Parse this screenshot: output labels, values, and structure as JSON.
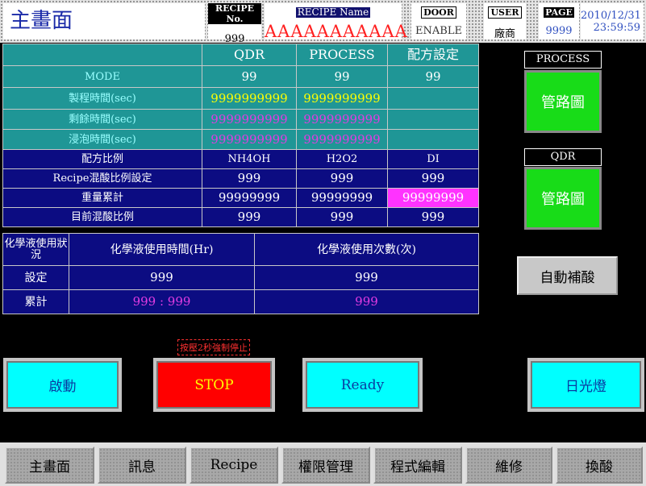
{
  "header": {
    "title": "主畫面",
    "recipe_no_label": "RECIPE No.",
    "recipe_no_value": "999",
    "recipe_name_label": "RECIPE Name",
    "recipe_name_value": "AAAAAAAAAAA",
    "door_label": "DOOR",
    "door_value": "ENABLE",
    "user_label": "USER",
    "user_value": "廠商",
    "page_label": "PAGE",
    "page_value": "9999",
    "date": "2010/12/31",
    "time": "23:59:59"
  },
  "main_table": {
    "columns": [
      "QDR",
      "PROCESS",
      "配方設定"
    ],
    "rows": {
      "mode": {
        "label": "MODE",
        "values": [
          "99",
          "99",
          "99"
        ]
      },
      "process_time": {
        "label": "製程時間(sec)",
        "values": [
          "9999999999",
          "9999999999",
          ""
        ]
      },
      "remain_time": {
        "label": "剩餘時間(sec)",
        "values": [
          "9999999999",
          "9999999999",
          ""
        ]
      },
      "soak_time": {
        "label": "浸泡時間(sec)",
        "values": [
          "9999999999",
          "9999999999",
          ""
        ]
      },
      "ratio": {
        "label": "配方比例",
        "values": [
          "NH4OH",
          "H2O2",
          "DI"
        ]
      },
      "mix_setting": {
        "label": "Recipe混酸比例設定",
        "values": [
          "999",
          "999",
          "999"
        ]
      },
      "weight_total": {
        "label": "重量累計",
        "values": [
          "99999999",
          "99999999",
          "99999999"
        ]
      },
      "current_ratio": {
        "label": "目前混酸比例",
        "values": [
          "999",
          "999",
          "999"
        ]
      }
    }
  },
  "chem_table": {
    "corner": "化學液使用狀況",
    "col_hours": "化學液使用時間(Hr)",
    "col_count": "化學液使用次數(次)",
    "setting_label": "設定",
    "setting_hours": "999",
    "setting_count": "999",
    "total_label": "累計",
    "total_hours": "999 : 999",
    "total_count": "999"
  },
  "side": {
    "process_title": "PROCESS",
    "process_btn": "管路圖",
    "qdr_title": "QDR",
    "qdr_btn": "管路圖",
    "auto_refill": "自動補酸"
  },
  "controls": {
    "stop_note": "按壓2秒強制停止",
    "start": "啟動",
    "stop": "STOP",
    "ready": "Ready",
    "lamp": "日光燈"
  },
  "nav": [
    "主畫面",
    "訊息",
    "Recipe",
    "權限管理",
    "程式編輯",
    "維修",
    "換酸"
  ],
  "colors": {
    "teal": "#1f9696",
    "navy": "#0c0c82",
    "highlight_magenta": "#ff33ff",
    "green_button": "#18dc18",
    "cyan_button": "#00ffff",
    "stop_red": "#ff0000"
  }
}
